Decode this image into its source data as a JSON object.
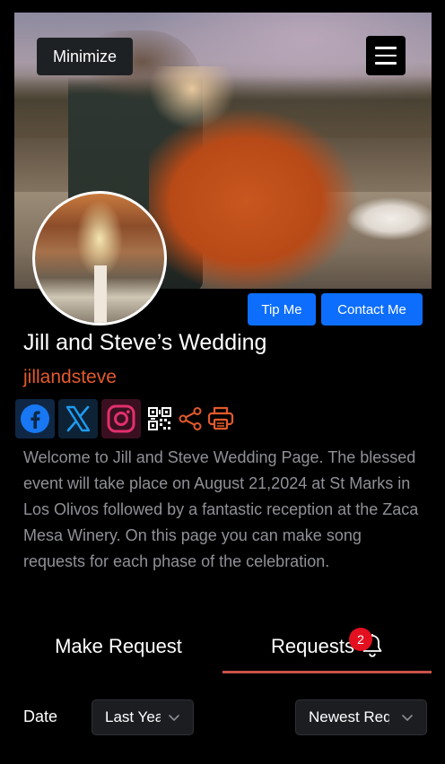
{
  "header": {
    "minimize_label": "Minimize",
    "menu_icon": "hamburger-menu-icon"
  },
  "profile": {
    "cover_photo": "couple-photo",
    "avatar_photo": "church-interior-photo",
    "tip_label": "Tip Me",
    "contact_label": "Contact Me",
    "title": "Jill and Steve’s Wedding",
    "handle": "jillandsteve",
    "handle_color": "#e35a2b"
  },
  "social": {
    "icons": [
      "facebook-icon",
      "x-icon",
      "instagram-icon",
      "qr-code-icon",
      "share-icon",
      "print-icon"
    ],
    "colors": {
      "facebook": "#1877f2",
      "x": "#1d9bf0",
      "instagram": "#e1306c",
      "tool": "#e35a2b"
    }
  },
  "description": "Welcome to Jill and Steve Wedding Page. The blessed event will take place on August 21,2024 at St Marks in Los Olivos followed by a fantastic reception at the Zaca Mesa Winery. On this page you can make song requests for each phase of the celebration.",
  "tabs": {
    "make_request_label": "Make Request",
    "requests_label": "Requests",
    "requests_badge": "2",
    "active": "Requests",
    "accent": "#c9524a"
  },
  "filters": {
    "date_label": "Date",
    "date_value": "Last Year",
    "sort_value": "Newest Requests"
  }
}
